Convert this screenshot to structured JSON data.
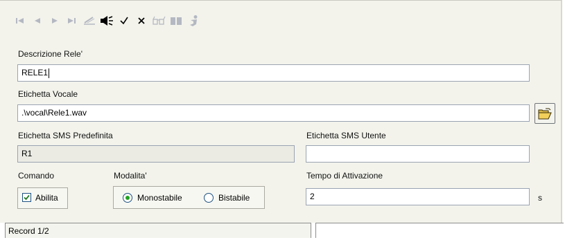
{
  "toolbar": {
    "buttons": [
      {
        "icon": "first-record-icon",
        "enabled": false
      },
      {
        "icon": "previous-record-icon",
        "enabled": false
      },
      {
        "icon": "next-record-icon",
        "enabled": false
      },
      {
        "icon": "last-record-icon",
        "enabled": false
      },
      {
        "icon": "edit-icon",
        "enabled": false
      },
      {
        "icon": "speaker-icon",
        "enabled": true
      },
      {
        "icon": "confirm-checkmark-icon",
        "enabled": true
      },
      {
        "icon": "cancel-x-icon",
        "enabled": true
      },
      {
        "icon": "glasses-icon",
        "enabled": false
      },
      {
        "icon": "book-icon",
        "enabled": false
      },
      {
        "icon": "person-icon",
        "enabled": false
      }
    ]
  },
  "form": {
    "descrizione": {
      "label": "Descrizione Rele'",
      "value": "RELE1"
    },
    "etichetta_vocale": {
      "label": "Etichetta Vocale",
      "value": ".\\vocal\\Rele1.wav"
    },
    "sms_predefinita": {
      "label": "Etichetta SMS Predefinita",
      "value": "R1"
    },
    "sms_utente": {
      "label": "Etichetta SMS Utente",
      "value": ""
    },
    "comando": {
      "label": "Comando",
      "checkbox_label": "Abilita",
      "checked": true
    },
    "modalita": {
      "label": "Modalita'",
      "options": [
        "Monostabile",
        "Bistabile"
      ],
      "selected": "Monostabile"
    },
    "tempo": {
      "label": "Tempo di Attivazione",
      "value": "2",
      "unit": "s"
    }
  },
  "status": {
    "record": "Record 1/2"
  },
  "colors": {
    "background": "#f3f3ec",
    "radio_selected": "#21a121",
    "check": "#1e7a1e",
    "field_border": "#9aa3b1"
  }
}
